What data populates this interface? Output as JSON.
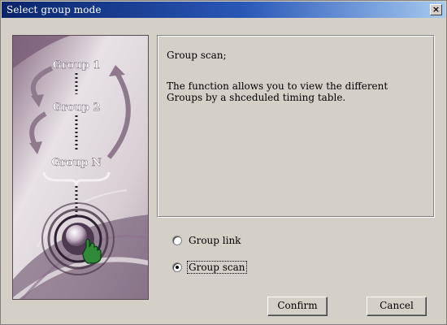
{
  "window": {
    "title": "Select group mode",
    "close_label": "×"
  },
  "illustration": {
    "group_labels": [
      "Group 1",
      "Group 2",
      "Group N"
    ]
  },
  "description": {
    "title": "Group scan;",
    "body": "The function allows you to view the different Groups by a shceduled timing table."
  },
  "options": [
    {
      "label": "Group link",
      "checked": false
    },
    {
      "label": "Group scan",
      "checked": true
    }
  ],
  "buttons": {
    "confirm": "Confirm",
    "cancel": "Cancel"
  }
}
